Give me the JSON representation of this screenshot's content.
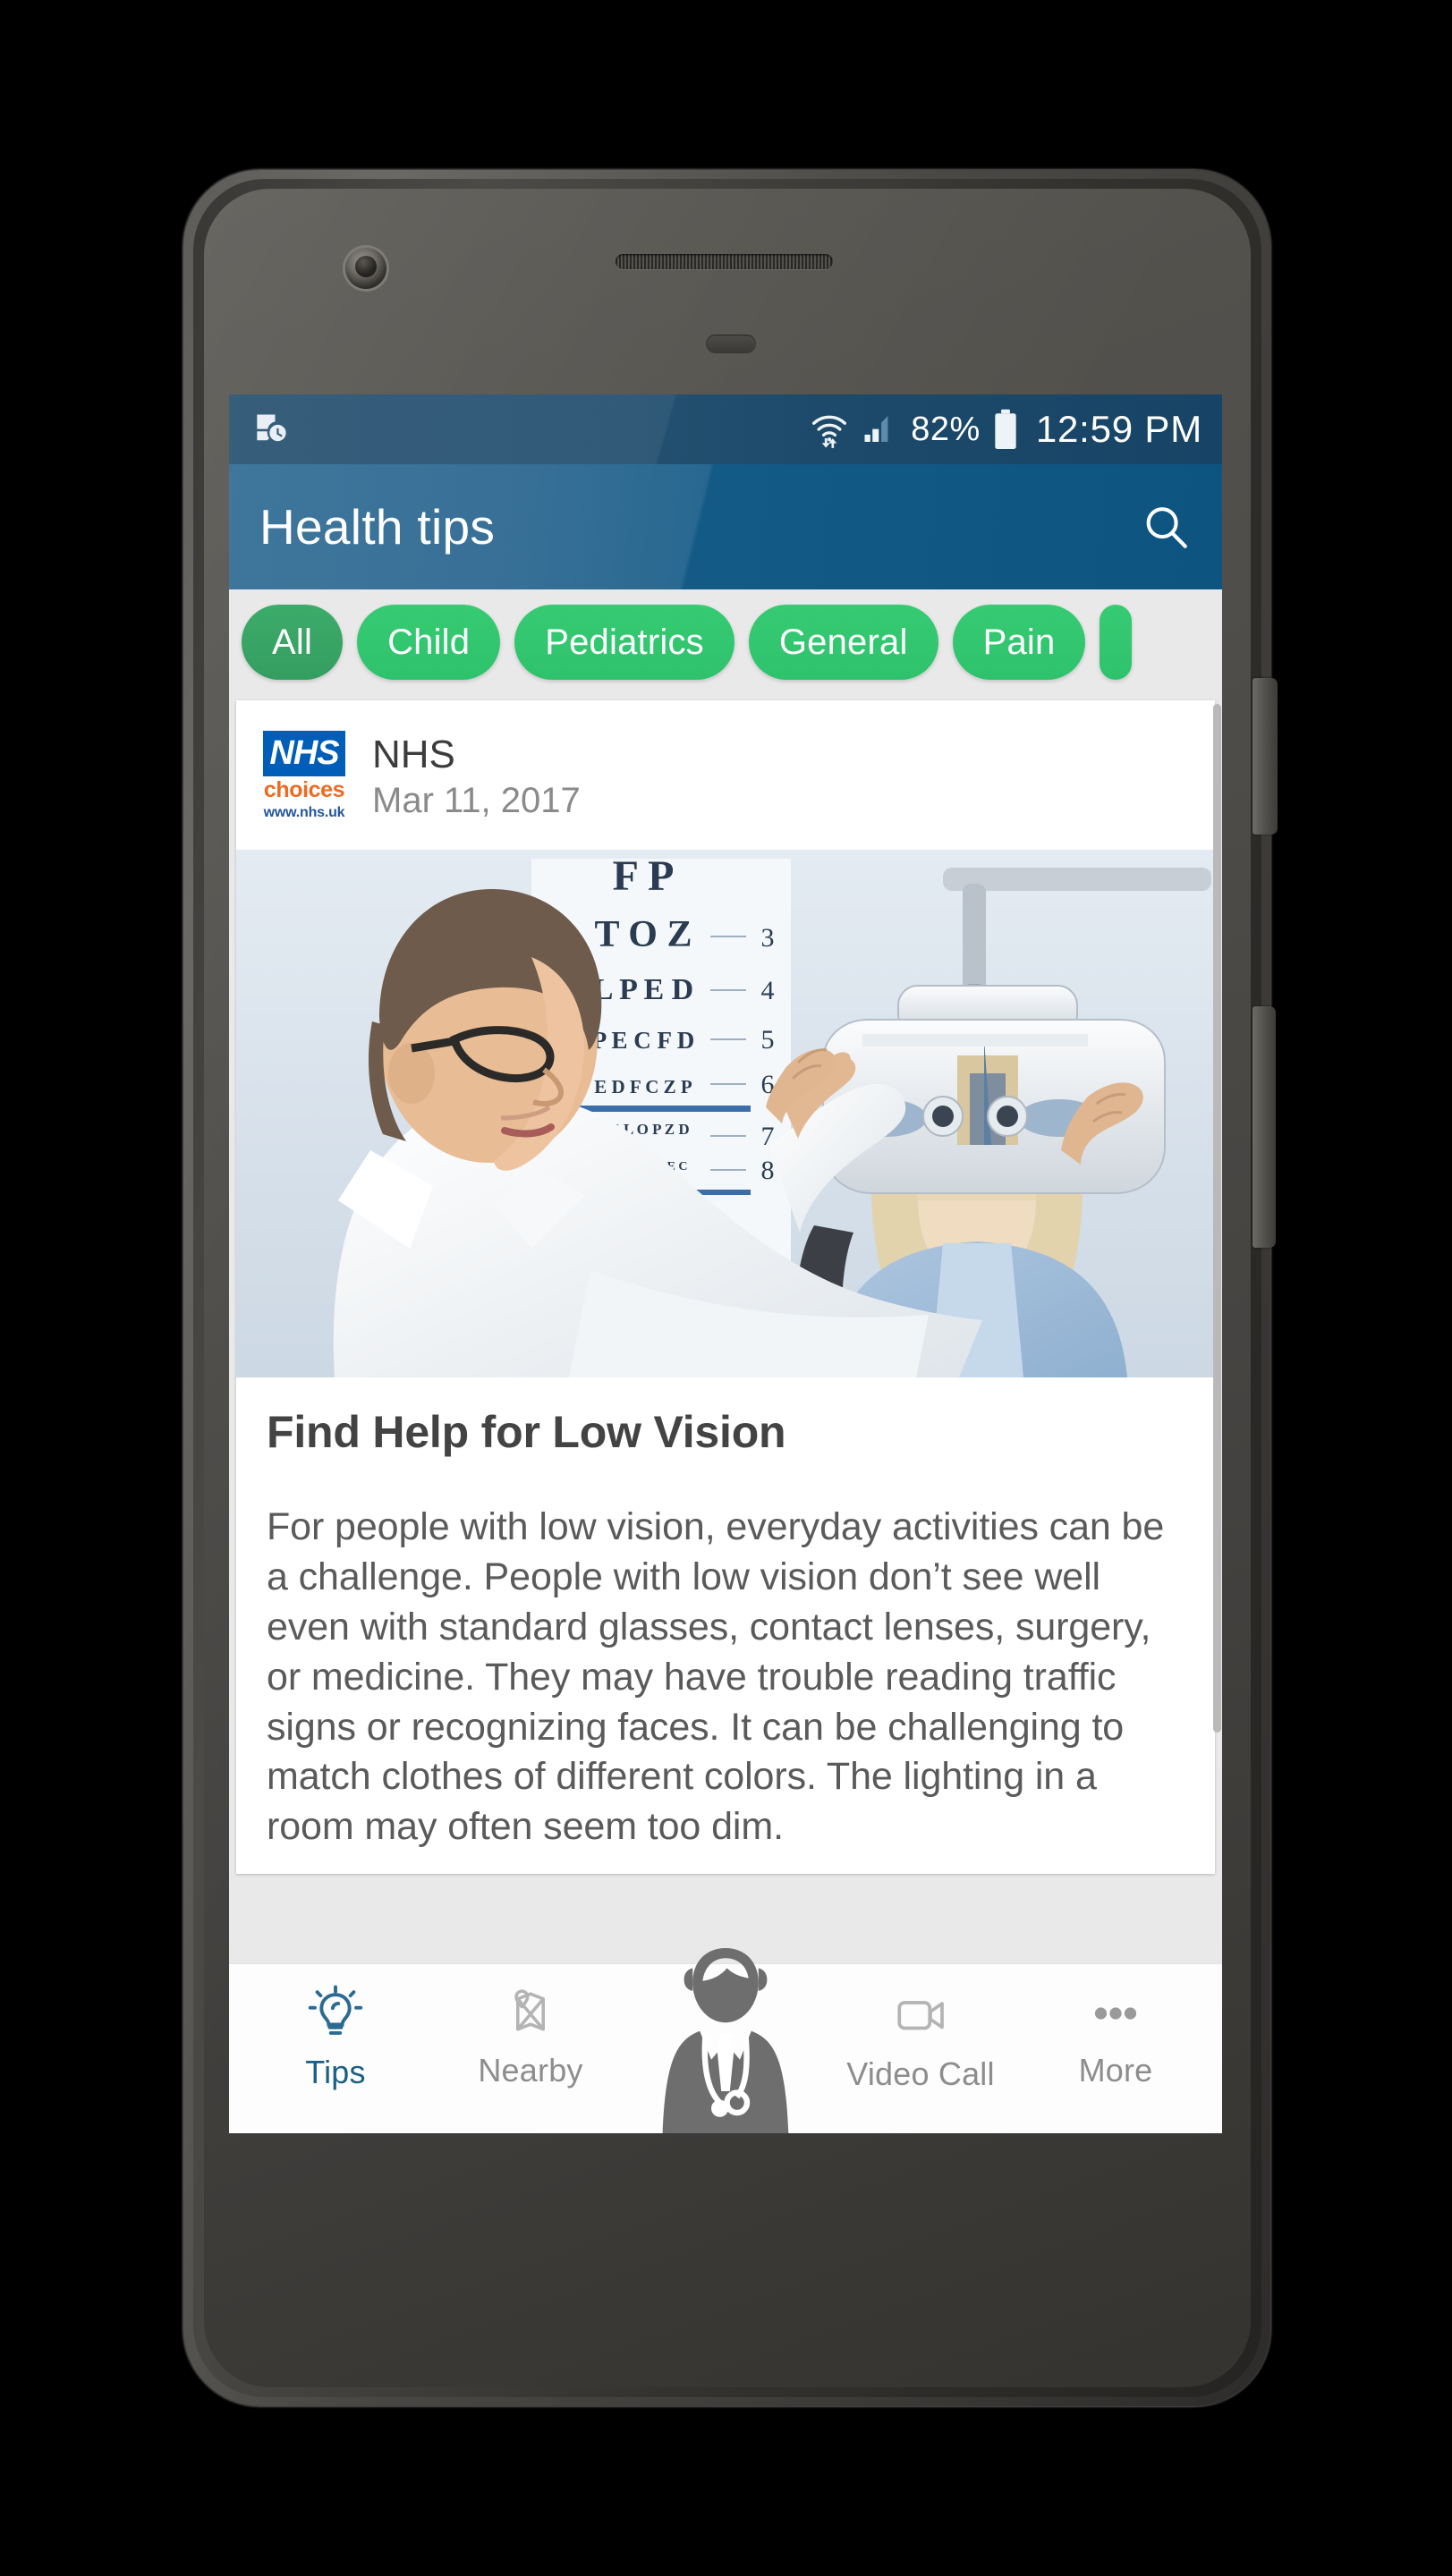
{
  "device": {
    "frame_color": "#4a4845",
    "buttons": [
      "power-button",
      "volume-button"
    ]
  },
  "statusbar": {
    "left_icons": [
      "device-clock-icon"
    ],
    "right_icons": [
      "wifi-transfer-icon",
      "cellular-signal-icon",
      "battery-icon"
    ],
    "battery_percent": "82%",
    "time": "12:59 PM",
    "background": "#1d4a6a"
  },
  "appbar": {
    "title": "Health tips",
    "search_icon": "search-icon",
    "background": "#145a86"
  },
  "chips": {
    "selected_index": 0,
    "items": [
      {
        "label": "All",
        "selected": true
      },
      {
        "label": "Child",
        "selected": false
      },
      {
        "label": "Pediatrics",
        "selected": false
      },
      {
        "label": "General",
        "selected": false
      },
      {
        "label": "Pain",
        "selected": false
      },
      {
        "label": "",
        "selected": false
      }
    ],
    "selected_color": "#349e60",
    "normal_color": "#2ec26c"
  },
  "card": {
    "logo": {
      "mark": "NHS",
      "sub": "choices",
      "url": "www.nhs.uk",
      "mark_bg": "#005eb8",
      "sub_color": "#ee6a20",
      "url_color": "#21569c"
    },
    "source": "NHS",
    "date": "Mar 11, 2017",
    "photo_alt": "optometrist-adjusting-phoropter-on-patient",
    "eye_chart_rows": [
      "F P",
      "T O Z",
      "L P E D",
      "P E C F D",
      "E D F C Z P",
      "F E L O P Z D",
      "D E F P O T E C"
    ],
    "eye_chart_numbers": [
      "3",
      "4",
      "5",
      "6",
      "7",
      "8"
    ],
    "title": "Find Help for Low Vision",
    "body": "For people with low vision, everyday activities can be a challenge. People with low vision don’t see well even with standard glasses, contact lenses, surgery, or medicine. They may have trouble reading traffic signs or recognizing faces. It can be challenging to match clothes of different colors. The lighting in a room may often seem too dim."
  },
  "bottomnav": {
    "active_index": 0,
    "active_color": "#1a5f85",
    "inactive_color": "#8d8d8d",
    "items": [
      {
        "label": "Tips",
        "icon": "lightbulb-icon",
        "active": true
      },
      {
        "label": "Nearby",
        "icon": "map-icon",
        "active": false
      },
      {
        "label": "",
        "icon": "doctor-avatar-icon",
        "active": false
      },
      {
        "label": "Video Call",
        "icon": "video-camera-icon",
        "active": false
      },
      {
        "label": "More",
        "icon": "more-dots-icon",
        "active": false
      }
    ]
  }
}
